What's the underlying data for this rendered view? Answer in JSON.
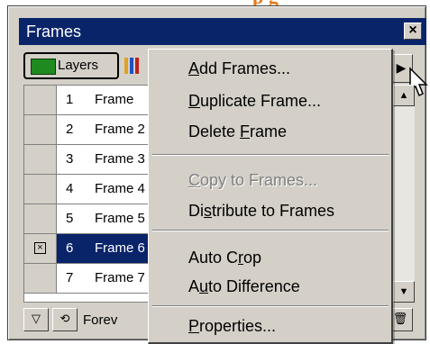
{
  "top_fragment_text": "p   g",
  "panel": {
    "title": "Frames",
    "close_glyph": "×",
    "tabs": [
      {
        "label": "Layers"
      }
    ],
    "more_arrow": "▶",
    "loop_label": "Forev"
  },
  "frames": [
    {
      "number": "1",
      "name": "Frame",
      "checked": false,
      "selected": false
    },
    {
      "number": "2",
      "name": "Frame 2",
      "checked": false,
      "selected": false
    },
    {
      "number": "3",
      "name": "Frame 3",
      "checked": false,
      "selected": false
    },
    {
      "number": "4",
      "name": "Frame 4",
      "checked": false,
      "selected": false
    },
    {
      "number": "5",
      "name": "Frame 5",
      "checked": false,
      "selected": false
    },
    {
      "number": "6",
      "name": "Frame 6",
      "checked": true,
      "selected": true
    },
    {
      "number": "7",
      "name": "Frame 7",
      "checked": false,
      "selected": false
    }
  ],
  "menu": {
    "items": [
      {
        "pre": "",
        "u": "A",
        "post": "dd Frames...",
        "disabled": false
      },
      {
        "pre": "",
        "u": "D",
        "post": "uplicate Frame...",
        "disabled": false
      },
      {
        "pre": "Delete ",
        "u": "F",
        "post": "rame",
        "disabled": false
      },
      {
        "pre": "",
        "u": "C",
        "post": "opy to Frames...",
        "disabled": true
      },
      {
        "pre": "Di",
        "u": "s",
        "post": "tribute to Frames",
        "disabled": false
      },
      {
        "pre": "Auto C",
        "u": "r",
        "post": "op",
        "disabled": false
      },
      {
        "pre": "A",
        "u": "u",
        "post": "to Difference",
        "disabled": false
      },
      {
        "pre": "",
        "u": "P",
        "post": "roperties...",
        "disabled": false
      }
    ]
  },
  "colors": {
    "titlebar": "#0a246a",
    "selection": "#0a246a",
    "face": "#d4d0c8",
    "accent_orange": "#e87a1c"
  }
}
